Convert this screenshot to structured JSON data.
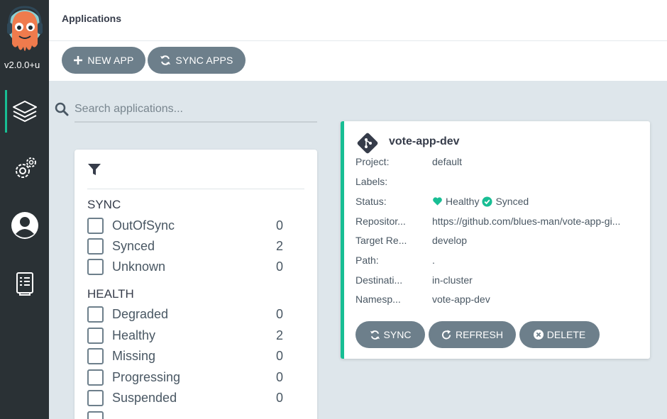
{
  "sidebar": {
    "version": "v2.0.0+u",
    "items": [
      {
        "name": "applications"
      },
      {
        "name": "settings"
      },
      {
        "name": "user-info"
      },
      {
        "name": "documentation"
      }
    ]
  },
  "header": {
    "title": "Applications"
  },
  "toolbar": {
    "new_app_label": "NEW APP",
    "sync_apps_label": "SYNC APPS"
  },
  "search": {
    "placeholder": "Search applications...",
    "value": ""
  },
  "filters": {
    "sync": {
      "title": "SYNC",
      "items": [
        {
          "label": "OutOfSync",
          "count": "0"
        },
        {
          "label": "Synced",
          "count": "2"
        },
        {
          "label": "Unknown",
          "count": "0"
        }
      ]
    },
    "health": {
      "title": "HEALTH",
      "items": [
        {
          "label": "Degraded",
          "count": "0"
        },
        {
          "label": "Healthy",
          "count": "2"
        },
        {
          "label": "Missing",
          "count": "0"
        },
        {
          "label": "Progressing",
          "count": "0"
        },
        {
          "label": "Suspended",
          "count": "0"
        }
      ]
    }
  },
  "app_card": {
    "name": "vote-app-dev",
    "fields": [
      {
        "key": "Project:",
        "value": "default"
      },
      {
        "key": "Labels:",
        "value": ""
      },
      {
        "key": "Status:",
        "health": "Healthy",
        "sync": "Synced"
      },
      {
        "key": "Repositor...",
        "value": "https://github.com/blues-man/vote-app-gi..."
      },
      {
        "key": "Target Re...",
        "value": "develop"
      },
      {
        "key": "Path:",
        "value": "."
      },
      {
        "key": "Destinati...",
        "value": "in-cluster"
      },
      {
        "key": "Namesp...",
        "value": "vote-app-dev"
      }
    ],
    "buttons": {
      "sync": "SYNC",
      "refresh": "REFRESH",
      "delete": "DELETE"
    }
  },
  "colors": {
    "accent": "#18be94",
    "button": "#6d7f8b",
    "sidebar": "#2a3135",
    "background": "#dee6eb"
  }
}
